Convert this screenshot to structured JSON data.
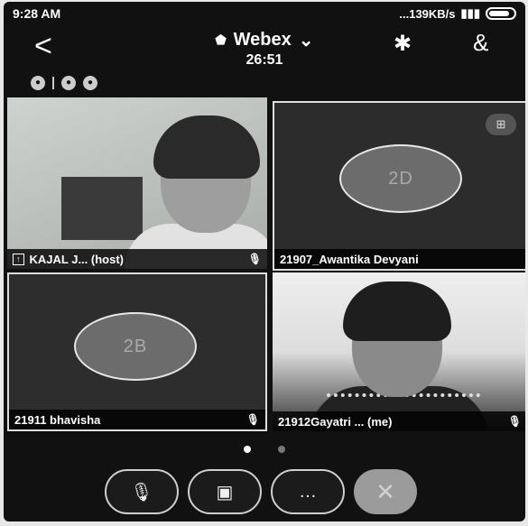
{
  "status_bar": {
    "time": "9:28 AM",
    "network": "...139KB/s",
    "battery_icon": "battery-icon"
  },
  "header": {
    "app_title": "Webex",
    "title_chevron": "⌄",
    "timer": "26:51",
    "back_icon": "<",
    "bluetooth_icon": "✱",
    "participants_icon": "&"
  },
  "mini_icons": [
    "●",
    "●",
    "●"
  ],
  "tiles": [
    {
      "name": "KAJAL J... (host)",
      "share_badge": "↑",
      "mic": "🎙"
    },
    {
      "name": "21907_Awantika Devyani",
      "initials": "2D",
      "layout_icon": "⊞"
    },
    {
      "name": "21911 bhavisha",
      "initials": "2B",
      "mic": "🎙"
    },
    {
      "name": "21912Gayatri ... (me)",
      "mic": "🎙"
    }
  ],
  "page_dots": {
    "active": 0,
    "count": 2
  },
  "controls": {
    "mute": "🎙",
    "video": "▣",
    "more": "…",
    "end": "✕"
  }
}
